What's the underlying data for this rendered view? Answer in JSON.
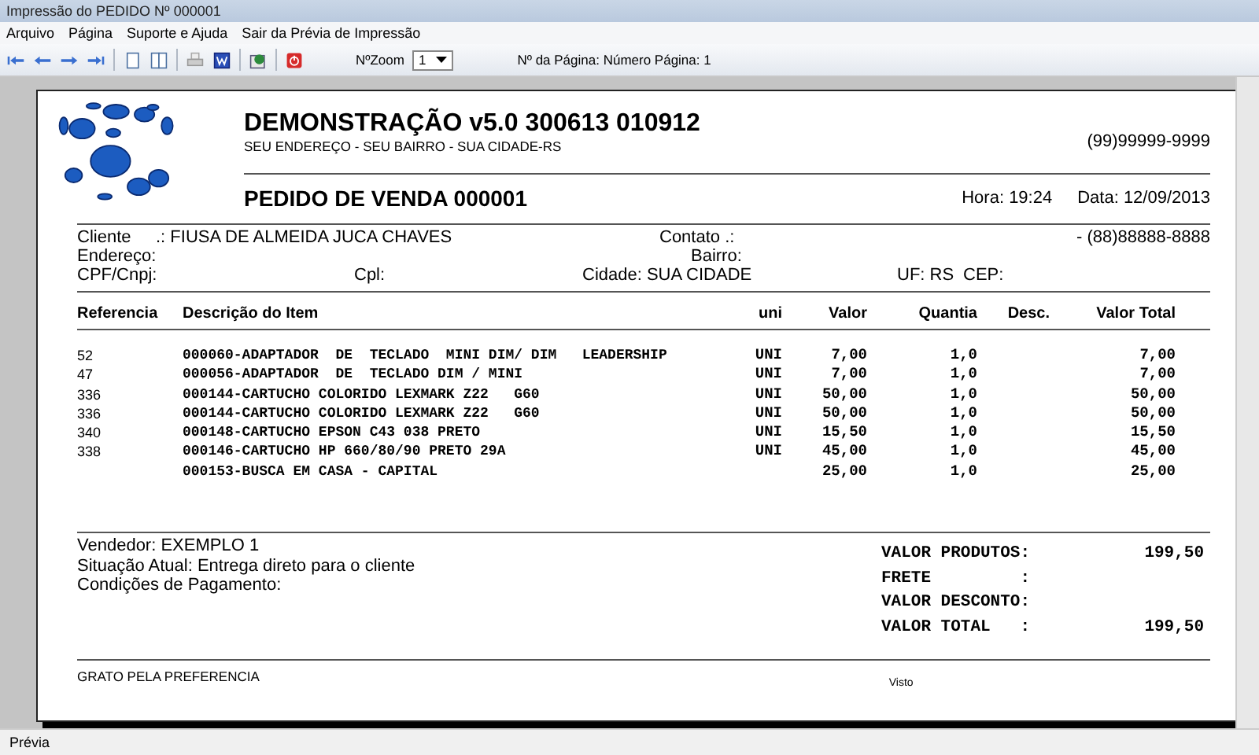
{
  "window": {
    "title": "Impressão do PEDIDO Nº 000001"
  },
  "menu": [
    "Arquivo",
    "Página",
    "Suporte e Ajuda",
    "Sair da Prévia de Impressão"
  ],
  "toolbar": {
    "zoom_label": "NºZoom",
    "zoom_value": "1",
    "page_info": "Nº da Página: Número Página: 1"
  },
  "document": {
    "company": "DEMONSTRAÇÃO v5.0 300613 010912",
    "address": "SEU ENDEREÇO - SEU BAIRRO - SUA CIDADE-RS",
    "phone": "(99)99999-9999",
    "order_title": "PEDIDO DE VENDA 000001",
    "time": "Hora: 19:24",
    "date": "Data: 12/09/2013",
    "client_label": "Cliente",
    "client_value": ".: FIUSA DE ALMEIDA JUCA CHAVES",
    "contact_label": "Contato .:",
    "contact_phone": "- (88)88888-8888",
    "address_label": "Endereço:",
    "district_label": "Bairro:",
    "cpf_label": "CPF/Cnpj:",
    "cpl_label": "Cpl:",
    "city": "Cidade: SUA CIDADE",
    "uf": "UF: RS",
    "cep_label": "CEP:",
    "columns": [
      "Referencia",
      "Descrição do Item",
      "uni",
      "Valor",
      "Quantia",
      "Desc.",
      "Valor Total"
    ],
    "rows": [
      {
        "ref": "52",
        "description": "000060-ADAPTADOR  DE  TECLADO  MINI DIM/ DIM   LEADERSHIP",
        "unit": "UNI",
        "price": "7,00",
        "quantity": "1,0",
        "total": "7,00"
      },
      {
        "ref": "47",
        "description": "000056-ADAPTADOR  DE  TECLADO DIM / MINI",
        "unit": "UNI",
        "price": "7,00",
        "quantity": "1,0",
        "total": "7,00"
      },
      {
        "ref": "336",
        "description": "000144-CARTUCHO COLORIDO LEXMARK Z22   G60",
        "unit": "UNI",
        "price": "50,00",
        "quantity": "1,0",
        "total": "50,00"
      },
      {
        "ref": "336",
        "description": "000144-CARTUCHO COLORIDO LEXMARK Z22   G60",
        "unit": "UNI",
        "price": "50,00",
        "quantity": "1,0",
        "total": "50,00"
      },
      {
        "ref": "340",
        "description": "000148-CARTUCHO EPSON C43 038 PRETO",
        "unit": "UNI",
        "price": "15,50",
        "quantity": "1,0",
        "total": "15,50"
      },
      {
        "ref": "338",
        "description": "000146-CARTUCHO HP 660/80/90 PRETO 29A",
        "unit": "UNI",
        "price": "45,00",
        "quantity": "1,0",
        "total": "45,00"
      },
      {
        "description": "000153-BUSCA EM CASA - CAPITAL",
        "price": "25,00",
        "quantity": "1,0",
        "total": "25,00"
      }
    ],
    "notes": [
      "Vendedor: EXEMPLO 1",
      "Situação Atual: Entrega direto para o cliente",
      "Condições de Pagamento:"
    ],
    "totals": [
      {
        "label": "VALOR PRODUTOS:",
        "value": "199,50"
      },
      {
        "label": "FRETE         :"
      },
      {
        "label": "VALOR DESCONTO:"
      },
      {
        "label": "VALOR TOTAL   :",
        "value": "199,50"
      }
    ],
    "thanks": "GRATO PELA PREFERENCIA",
    "signature": "Visto"
  },
  "status_bar": "Prévia"
}
